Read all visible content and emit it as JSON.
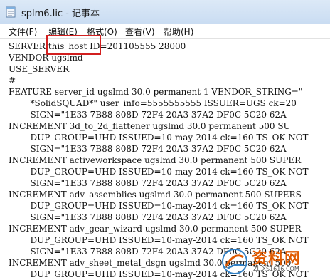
{
  "window": {
    "title": "splm6.lic - 记事本"
  },
  "menu": [
    {
      "label": "文件(F)"
    },
    {
      "label": "编辑(E)"
    },
    {
      "label": "格式(O)"
    },
    {
      "label": "查看(V)"
    },
    {
      "label": "帮助(H)"
    }
  ],
  "document": {
    "lines": [
      "SERVER this_host ID=201105555 28000",
      "VENDOR ugslmd",
      "USE_SERVER",
      "#",
      "FEATURE server_id ugslmd 30.0 permanent 1 VENDOR_STRING=\"",
      "        *SolidSQUAD*\" user_info=5555555555 ISSUER=UGS ck=20",
      "        SIGN=\"1E33 7B88 808D 72F4 20A3 37A2 DF0C 5C20 62A",
      "INCREMENT 3d_to_2d_flattener ugslmd 30.0 permanent 500 SU",
      "        DUP_GROUP=UHD ISSUED=10-may-2014 ck=160 TS_OK NOT",
      "        SIGN=\"1E33 7B88 808D 72F4 20A3 37A2 DF0C 5C20 62A",
      "INCREMENT activeworkspace ugslmd 30.0 permanent 500 SUPER",
      "        DUP_GROUP=UHD ISSUED=10-may-2014 ck=160 TS_OK NOT",
      "        SIGN=\"1E33 7B88 808D 72F4 20A3 37A2 DF0C 5C20 62A",
      "INCREMENT adv_assemblies ugslmd 30.0 permanent 500 SUPERS",
      "        DUP_GROUP=UHD ISSUED=10-may-2014 ck=160 TS_OK NOT",
      "        SIGN=\"1E33 7B88 808D 72F4 20A3 37A2 DF0C 5C20 62A",
      "INCREMENT adv_gear_wizard ugslmd 30.0 permanent 500 SUPER",
      "        DUP_GROUP=UHD ISSUED=10-may-2014 ck=160 TS_OK NOT",
      "        SIGN=\"1E33 7B88 808D 72F4 20A3 37A2 DF0C 5C20 62A",
      "INCREMENT adv_sheet_metal_dsgn ugslmd 30.0 permanent 500",
      "        DUP_GROUP=UHD ISSUED=10-may-2014 ck=160 TS_OK NOT"
    ]
  },
  "watermark": {
    "text": "资料网",
    "url": "ZL.XS1616.COM"
  },
  "colors": {
    "highlight": "#d21f1f",
    "watermark": "#e05a00"
  }
}
